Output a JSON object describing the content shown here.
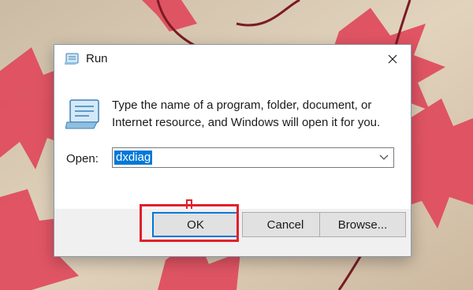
{
  "dialog": {
    "title": "Run",
    "description": "Type the name of a program, folder, document, or Internet resource, and Windows will open it for you.",
    "open_label": "Open:",
    "open_value": "dxdiag",
    "buttons": {
      "ok": "OK",
      "cancel": "Cancel",
      "browse": "Browse..."
    }
  },
  "icons": {
    "title": "run-icon",
    "body": "run-icon",
    "close": "close-icon",
    "dropdown": "chevron-down-icon",
    "annotation": "down-arrow-icon"
  },
  "colors": {
    "annotation": "#e0202c",
    "selection": "#0078d7",
    "button_focus": "#0078d7"
  }
}
